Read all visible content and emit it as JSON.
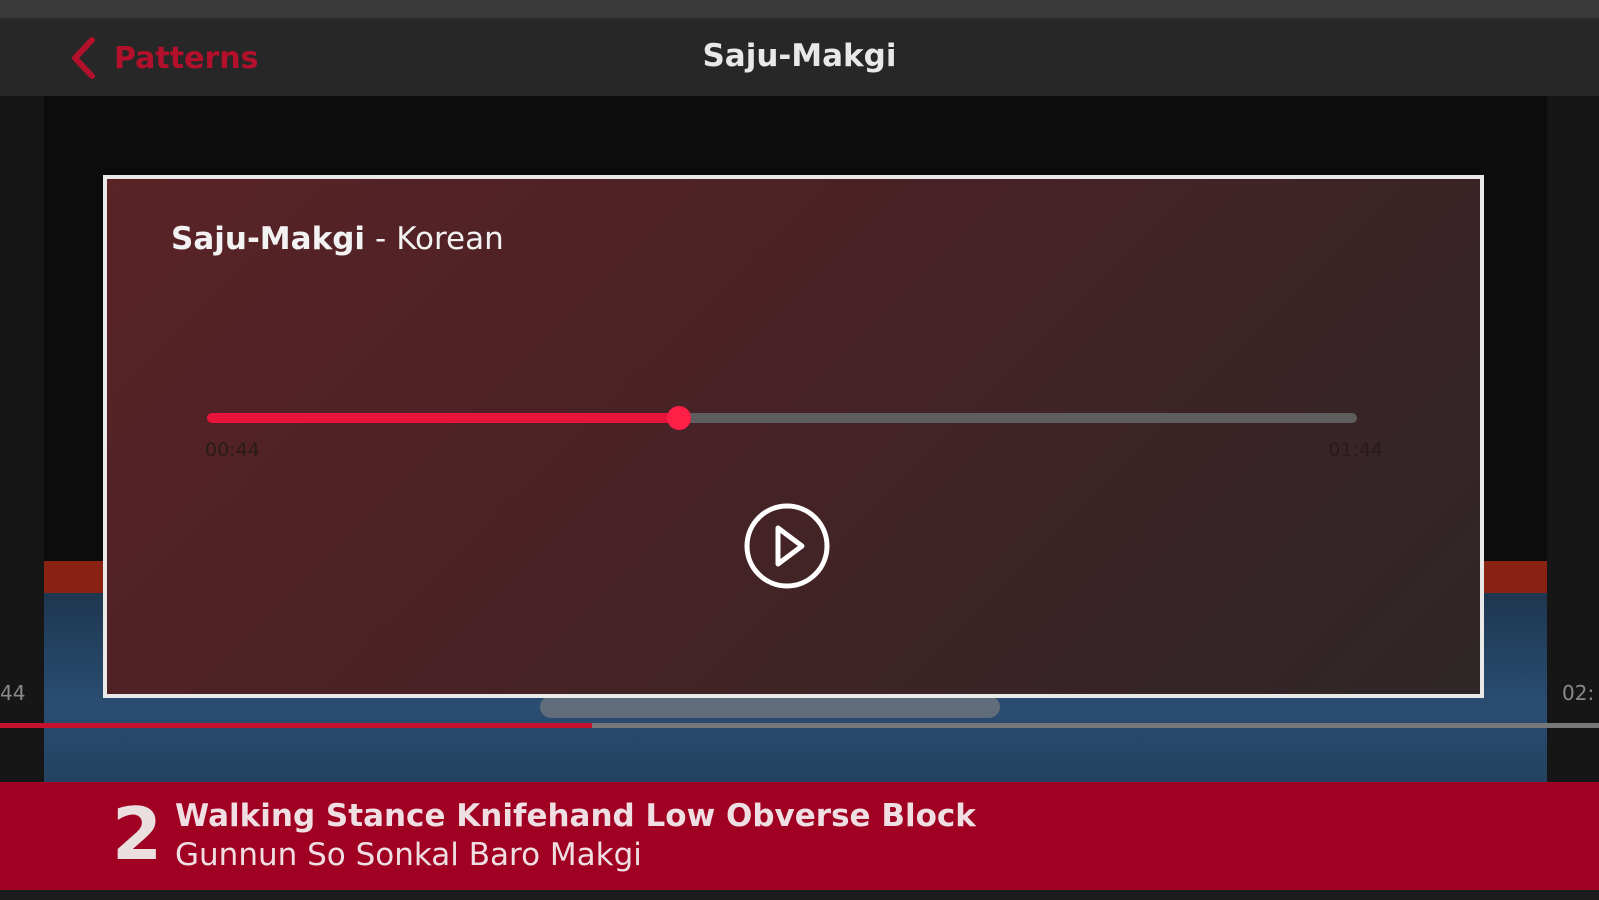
{
  "nav": {
    "back_label": "Patterns",
    "title": "Saju-Makgi"
  },
  "background_video": {
    "time_left": "44",
    "time_right": "02:",
    "progress_fraction": 0.37
  },
  "audio_card": {
    "title_bold": "Saju-Makgi",
    "separator": "-",
    "language": "Korean",
    "current_time": "00:44",
    "total_time": "01:44",
    "progress_fraction": 0.41,
    "accent_color": "#e8143a"
  },
  "step": {
    "number": "2",
    "english_name": "Walking Stance Knifehand Low Obverse Block",
    "korean_name": "Gunnun So Sonkal Baro Makgi",
    "banner_color": "#a00022"
  },
  "icons": {
    "back": "chevron-left-icon",
    "play": "play-circle-icon"
  }
}
